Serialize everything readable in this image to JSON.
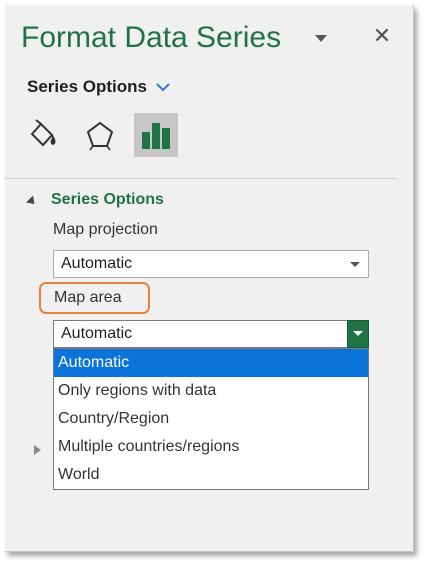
{
  "pane": {
    "title": "Format Data Series",
    "section_selector": "Series Options",
    "tabs": [
      {
        "icon": "fill-line-icon",
        "selected": false
      },
      {
        "icon": "effects-pentagon-icon",
        "selected": false
      },
      {
        "icon": "series-options-bar-chart-icon",
        "selected": true
      }
    ]
  },
  "series_options": {
    "group_label": "Series Options",
    "map_projection": {
      "label": "Map projection",
      "value": "Automatic"
    },
    "map_area": {
      "label": "Map area",
      "value": "Automatic",
      "options": [
        "Automatic",
        "Only regions with data",
        "Country/Region",
        "Multiple countries/regions",
        "World"
      ],
      "selected_index": 0
    }
  },
  "colors": {
    "accent_green": "#217346",
    "highlight_blue": "#0a74da",
    "annotation_orange": "#e8813a"
  }
}
